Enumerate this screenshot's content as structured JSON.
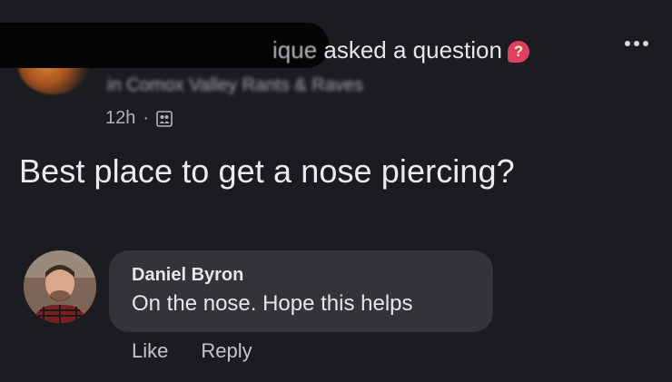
{
  "post": {
    "author_name_visible": "ique",
    "action_text": " asked a question",
    "question_badge": "?",
    "group_line": "in Comox Valley Rants & Raves",
    "timestamp": "12h",
    "separator": "·",
    "question": "Best place to get a nose piercing?"
  },
  "comment": {
    "author": "Daniel Byron",
    "text": "On the nose. Hope this helps",
    "actions": {
      "like": "Like",
      "reply": "Reply"
    }
  },
  "icons": {
    "privacy": "group-members-icon",
    "more": "more-options-icon",
    "badge": "question-badge-icon"
  },
  "colors": {
    "background": "#1b1c1f",
    "bubble": "#333437",
    "badge": "#e0405f"
  }
}
